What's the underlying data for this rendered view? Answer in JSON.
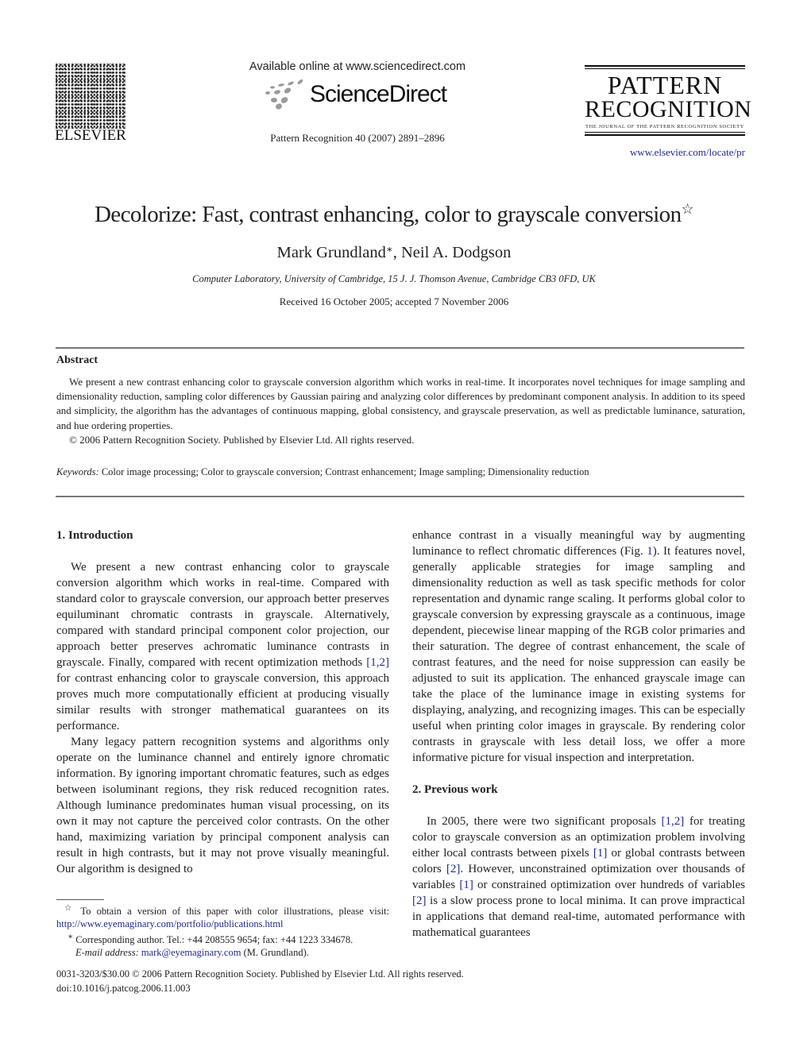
{
  "header": {
    "publisher_logo_text": "ELSEVIER",
    "available_online": "Available online at www.sciencedirect.com",
    "sciencedirect_brand": "ScienceDirect",
    "journal_reference": "Pattern Recognition 40 (2007) 2891–2896",
    "journal_logo": {
      "line1": "PATTERN",
      "line2": "RECOGNITION",
      "subtitle": "THE JOURNAL OF THE PATTERN RECOGNITION SOCIETY"
    },
    "journal_url": "www.elsevier.com/locate/pr"
  },
  "article": {
    "title": "Decolorize: Fast, contrast enhancing, color to grayscale conversion",
    "title_mark": "☆",
    "authors": [
      {
        "name": "Mark Grundland",
        "mark": "∗"
      },
      {
        "name": "Neil A. Dodgson",
        "mark": ""
      }
    ],
    "author_separator": ", ",
    "affiliation": "Computer Laboratory, University of Cambridge, 15 J. J. Thomson Avenue, Cambridge CB3 0FD, UK",
    "received": "Received 16 October 2005; accepted 7 November 2006"
  },
  "abstract": {
    "heading": "Abstract",
    "body": "We present a new contrast enhancing color to grayscale conversion algorithm which works in real-time. It incorporates novel techniques for image sampling and dimensionality reduction, sampling color differences by Gaussian pairing and analyzing color differences by predominant component analysis. In addition to its speed and simplicity, the algorithm has the advantages of continuous mapping, global consistency, and grayscale preservation, as well as predictable luminance, saturation, and hue ordering properties.",
    "copyright": "© 2006 Pattern Recognition Society. Published by Elsevier Ltd. All rights reserved.",
    "keywords_label": "Keywords:",
    "keywords": "Color image processing; Color to grayscale conversion; Contrast enhancement; Image sampling; Dimensionality reduction"
  },
  "sections": {
    "intro": {
      "heading": "1.  Introduction",
      "p1_a": "We present a new contrast enhancing color to grayscale conversion algorithm which works in real-time. Compared with standard color to grayscale conversion, our approach better preserves equiluminant chromatic contrasts in grayscale. Alternatively, compared with standard principal component color projection, our approach better preserves achromatic luminance contrasts in grayscale. Finally, compared with recent optimization methods ",
      "p1_ref": "[1,2]",
      "p1_b": " for contrast enhancing color to grayscale conversion, this approach proves much more computationally efficient at producing visually similar results with stronger mathematical guarantees on its performance.",
      "p2": "Many legacy pattern recognition systems and algorithms only operate on the luminance channel and entirely ignore chromatic information. By ignoring important chromatic features, such as edges between isoluminant regions, they risk reduced recognition rates. Although luminance predominates human visual processing, on its own it may not capture the perceived color contrasts. On the other hand, maximizing variation by principal component analysis can result in high contrasts, but it may not prove visually meaningful. Our algorithm is designed to",
      "p2_cont_a": "enhance contrast in a visually meaningful way by augmenting luminance to reflect chromatic differences (Fig. ",
      "p2_cont_ref": "1",
      "p2_cont_b": "). It features novel, generally applicable strategies for image sampling and dimensionality reduction as well as task specific methods for color representation and dynamic range scaling. It performs global color to grayscale conversion by expressing grayscale as a continuous, image dependent, piecewise linear mapping of the RGB color primaries and their saturation. The degree of contrast enhancement, the scale of contrast features, and the need for noise suppression can easily be adjusted to suit its application. The enhanced grayscale image can take the place of the luminance image in existing systems for displaying, analyzing, and recognizing images. This can be especially useful when printing color images in grayscale. By rendering color contrasts in grayscale with less detail loss, we offer a more informative picture for visual inspection and interpretation."
    },
    "previous": {
      "heading": "2.  Previous work",
      "t1": "In 2005, there were two significant proposals ",
      "r1": "[1,2]",
      "t2": " for treating color to grayscale conversion as an optimization problem involving either local contrasts between pixels ",
      "r2": "[1]",
      "t3": " or global contrasts between colors ",
      "r3": "[2]",
      "t4": ". However, unconstrained optimization over thousands of variables ",
      "r4": "[1]",
      "t5": " or constrained optimization over hundreds of variables ",
      "r5": "[2]",
      "t6": " is a slow process prone to local minima. It can prove impractical in applications that demand real-time, automated performance with mathematical guarantees"
    }
  },
  "footnotes": {
    "star_mark": "☆",
    "star_text": " To obtain a version of this paper with color illustrations, please visit: ",
    "star_url": "http://www.eyemaginary.com/portfolio/publications.html",
    "corr_mark": "∗",
    "corr_text": " Corresponding author. Tel.: +44 208555 9654; fax: +44 1223 334678.",
    "email_label": "E-mail address:",
    "email": "mark@eyemaginary.com",
    "email_suffix": " (M. Grundland)."
  },
  "footer": {
    "issn_line": "0031-3203/$30.00 © 2006 Pattern Recognition Society. Published by Elsevier Ltd. All rights reserved.",
    "doi": "doi:10.1016/j.patcog.2006.11.003"
  }
}
